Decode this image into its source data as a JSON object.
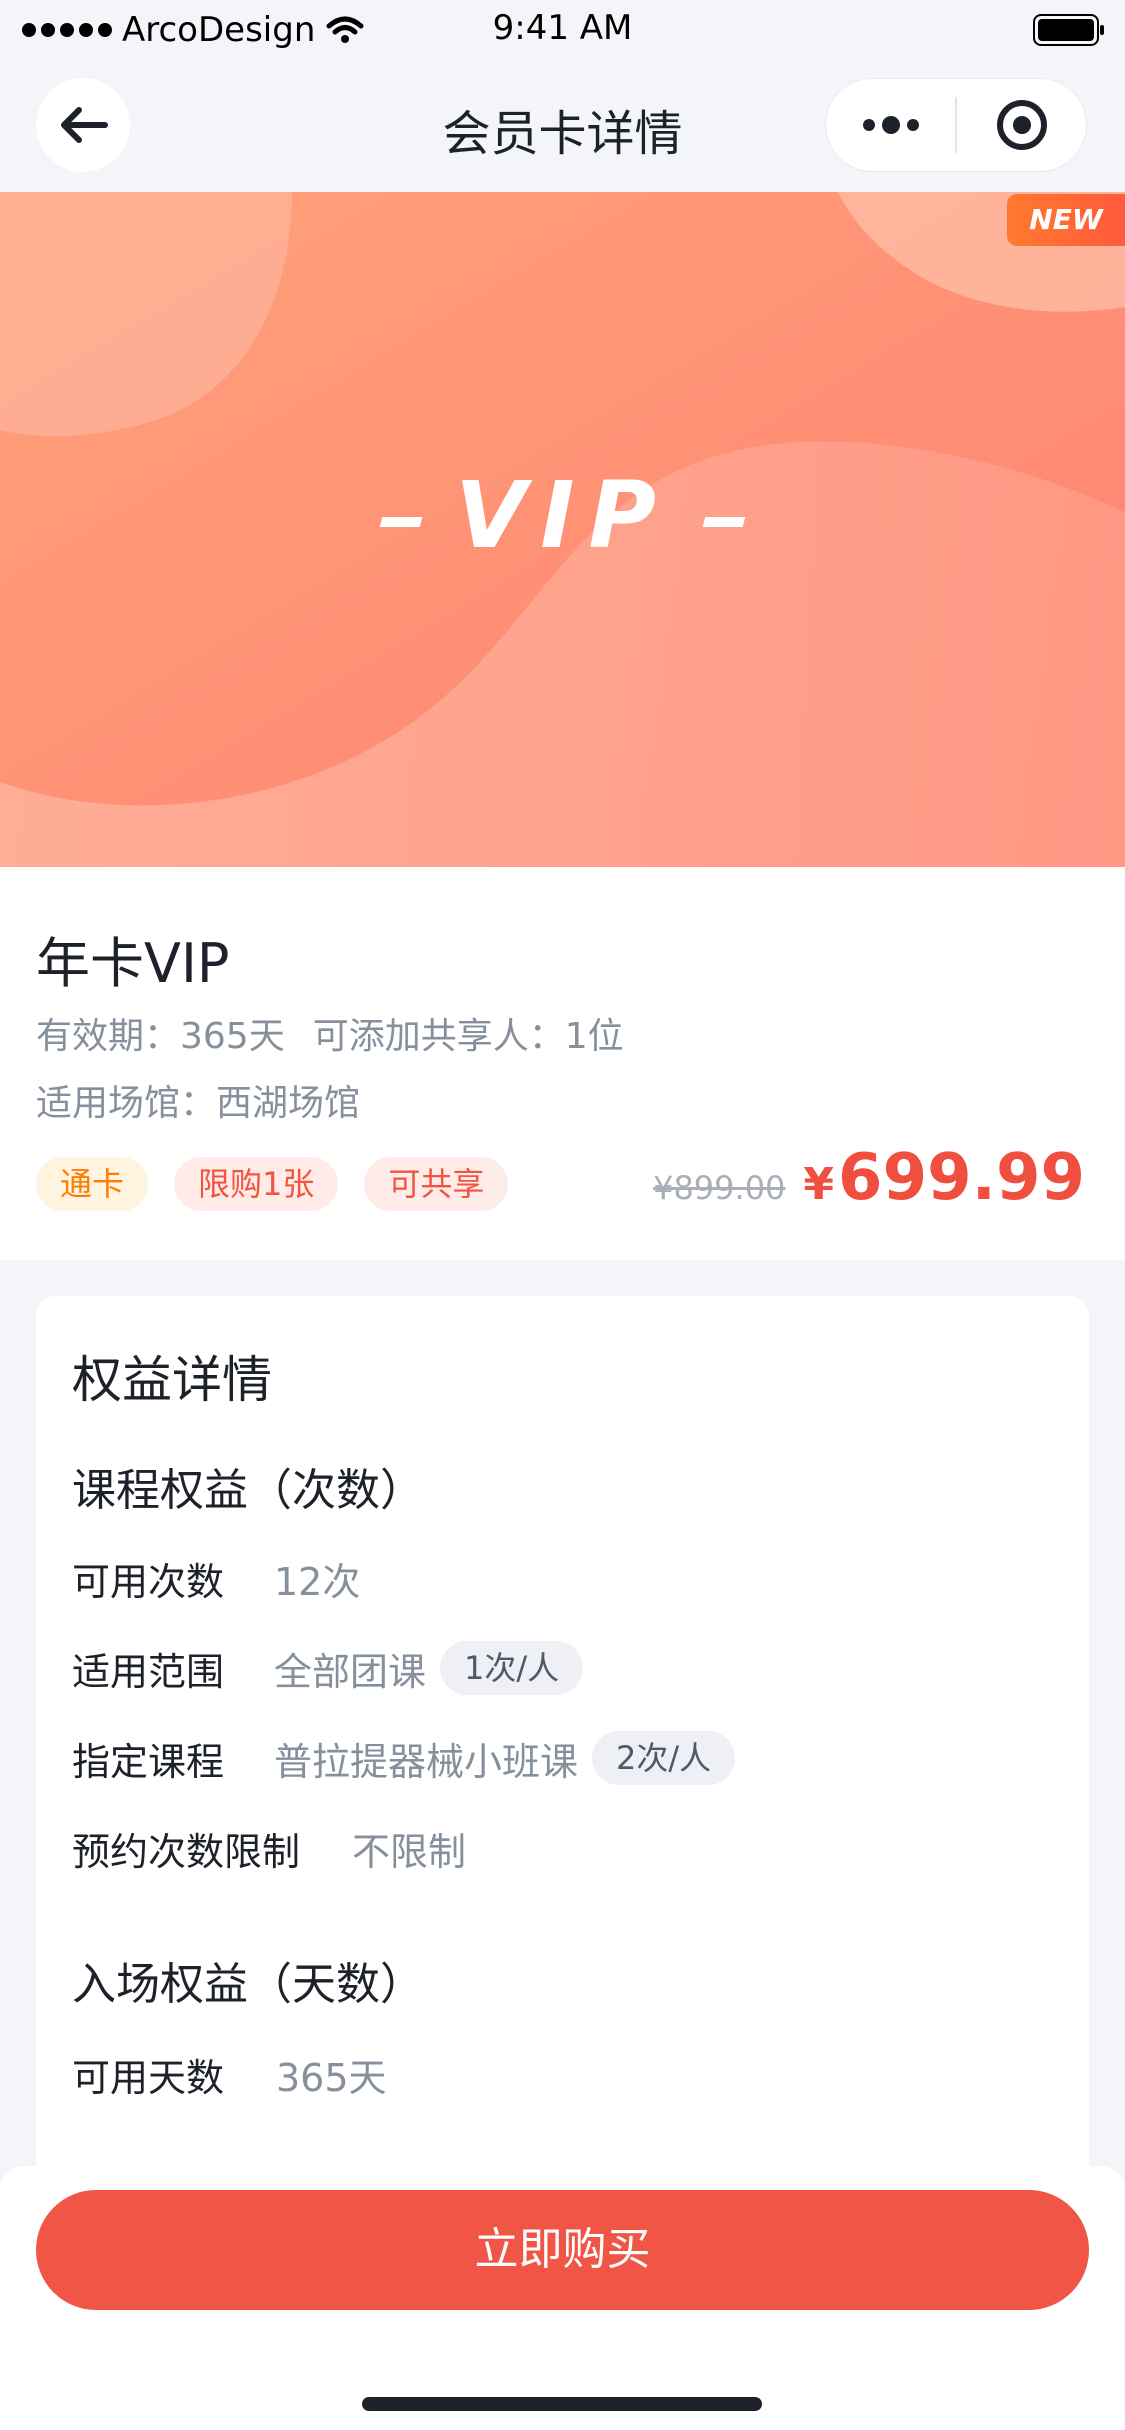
{
  "status_bar": {
    "carrier": "ArcoDesign",
    "time": "9:41 AM"
  },
  "nav": {
    "title": "会员卡详情",
    "back_icon": "arrow-left-icon",
    "more_icon": "more-dots-icon",
    "close_icon": "target-circle-icon"
  },
  "banner": {
    "title": "VIP",
    "badge": "NEW",
    "colors": {
      "start": "#ff9e72",
      "end": "#ff7d6e"
    }
  },
  "card": {
    "name": "年卡VIP",
    "validity": "有效期：365天",
    "sharers": "可添加共享人：1位",
    "venue": "适用场馆：西湖场馆",
    "tags": [
      "通卡",
      "限购1张",
      "可共享"
    ],
    "original_price": "¥899.00",
    "currency": "¥",
    "price": "699.99"
  },
  "benefits": {
    "title": "权益详情",
    "course_section": {
      "title": "课程权益（次数）",
      "rows": [
        {
          "label": "可用次数",
          "value": "12次"
        },
        {
          "label": "适用范围",
          "value": "全部团课",
          "pill": "1次/人"
        },
        {
          "label": "指定课程",
          "value": "普拉提器械小班课",
          "pill": "2次/人"
        },
        {
          "label": "预约次数限制",
          "value": "不限制"
        }
      ]
    },
    "entry_section": {
      "title": "入场权益（天数）",
      "rows": [
        {
          "label": "可用天数",
          "value": "365天"
        }
      ]
    }
  },
  "footer": {
    "buy_label": "立即购买",
    "accent": "#f05545"
  }
}
